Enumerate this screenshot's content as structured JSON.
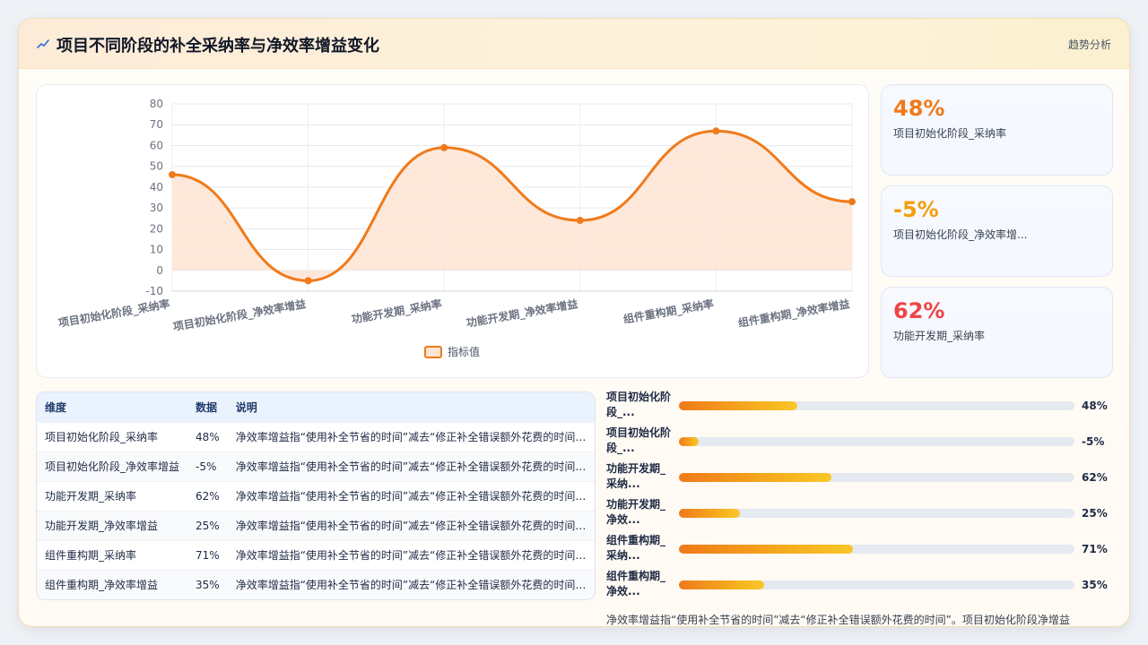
{
  "header": {
    "title": "项目不同阶段的补全采纳率与净效率增益变化",
    "tag": "趋势分析",
    "accent": "#f07a1a"
  },
  "chart_data": {
    "type": "line",
    "categories": [
      "项目初始化阶段_采纳率",
      "项目初始化阶段_净效率增益",
      "功能开发期_采纳率",
      "功能开发期_净效率增益",
      "组件重构期_采纳率",
      "组件重构期_净效率增益"
    ],
    "series": [
      {
        "name": "指标值",
        "values": [
          46,
          -5,
          59,
          24,
          67,
          33
        ]
      }
    ],
    "ylim": [
      -10,
      80
    ],
    "yticks": [
      80,
      70,
      60,
      50,
      40,
      30,
      20,
      10,
      0,
      -10
    ],
    "grid": true,
    "legend": "bottom",
    "line_color": "#f07a1a",
    "fill_color": "#fde4d3"
  },
  "kpis": [
    {
      "value": "48%",
      "label": "项目初始化阶段_采纳率",
      "color": "#f07a1a"
    },
    {
      "value": "-5%",
      "label": "项目初始化阶段_净效率增...",
      "color": "#f59e0b"
    },
    {
      "value": "62%",
      "label": "功能开发期_采纳率",
      "color": "#ef4444"
    }
  ],
  "table": {
    "headers": [
      "维度",
      "数据",
      "说明"
    ],
    "rows": [
      {
        "dim": "项目初始化阶段_采纳率",
        "val": "48%",
        "desc": "净效率增益指“使用补全节省的时间”减去“修正补全错误额外花费的时间”..."
      },
      {
        "dim": "项目初始化阶段_净效率增益",
        "val": "-5%",
        "desc": "净效率增益指“使用补全节省的时间”减去“修正补全错误额外花费的时间”..."
      },
      {
        "dim": "功能开发期_采纳率",
        "val": "62%",
        "desc": "净效率增益指“使用补全节省的时间”减去“修正补全错误额外花费的时间”..."
      },
      {
        "dim": "功能开发期_净效率增益",
        "val": "25%",
        "desc": "净效率增益指“使用补全节省的时间”减去“修正补全错误额外花费的时间”..."
      },
      {
        "dim": "组件重构期_采纳率",
        "val": "71%",
        "desc": "净效率增益指“使用补全节省的时间”减去“修正补全错误额外花费的时间”..."
      },
      {
        "dim": "组件重构期_净效率增益",
        "val": "35%",
        "desc": "净效率增益指“使用补全节省的时间”减去“修正补全错误额外花费的时间”..."
      }
    ]
  },
  "bars": [
    {
      "label": "项目初始化阶段_...",
      "value": "48%",
      "fill": 0.3
    },
    {
      "label": "项目初始化阶段_...",
      "value": "-5%",
      "fill": 0.05
    },
    {
      "label": "功能开发期_采纳...",
      "value": "62%",
      "fill": 0.385
    },
    {
      "label": "功能开发期_净效...",
      "value": "25%",
      "fill": 0.155
    },
    {
      "label": "组件重构期_采纳...",
      "value": "71%",
      "fill": 0.44
    },
    {
      "label": "组件重构期_净效...",
      "value": "35%",
      "fill": 0.215
    }
  ],
  "footnote": "净效率增益指“使用补全节省的时间”减去“修正补全错误额外花费的时间”。项目初始化阶段净增益"
}
